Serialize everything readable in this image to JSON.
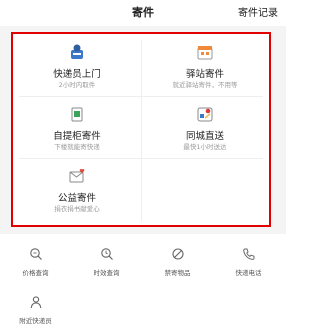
{
  "header": {
    "title": "寄件",
    "record_label": "寄件记录"
  },
  "services": [
    {
      "name": "快递员上门",
      "sub": "2小时内取件",
      "icon": "courier-icon"
    },
    {
      "name": "驿站寄件",
      "sub": "就近驿站寄件，不用等",
      "icon": "station-icon"
    },
    {
      "name": "自提柜寄件",
      "sub": "下楼就能寄快递",
      "icon": "locker-icon"
    },
    {
      "name": "同城直送",
      "sub": "最快1小时送达",
      "icon": "city-delivery-icon"
    },
    {
      "name": "公益寄件",
      "sub": "捐衣捐书献爱心",
      "icon": "charity-icon"
    }
  ],
  "quick_actions": [
    {
      "label": "价格查询",
      "icon": "price-search-icon"
    },
    {
      "label": "时效查询",
      "icon": "time-search-icon"
    },
    {
      "label": "禁寄物品",
      "icon": "prohibited-icon"
    },
    {
      "label": "快递电话",
      "icon": "phone-icon"
    },
    {
      "label": "附近快递员",
      "icon": "nearby-courier-icon"
    }
  ],
  "colors": {
    "highlight_border": "#e00000",
    "icon_blue": "#3a78c9",
    "icon_orange": "#f08a3a",
    "icon_green": "#3aa55a"
  }
}
